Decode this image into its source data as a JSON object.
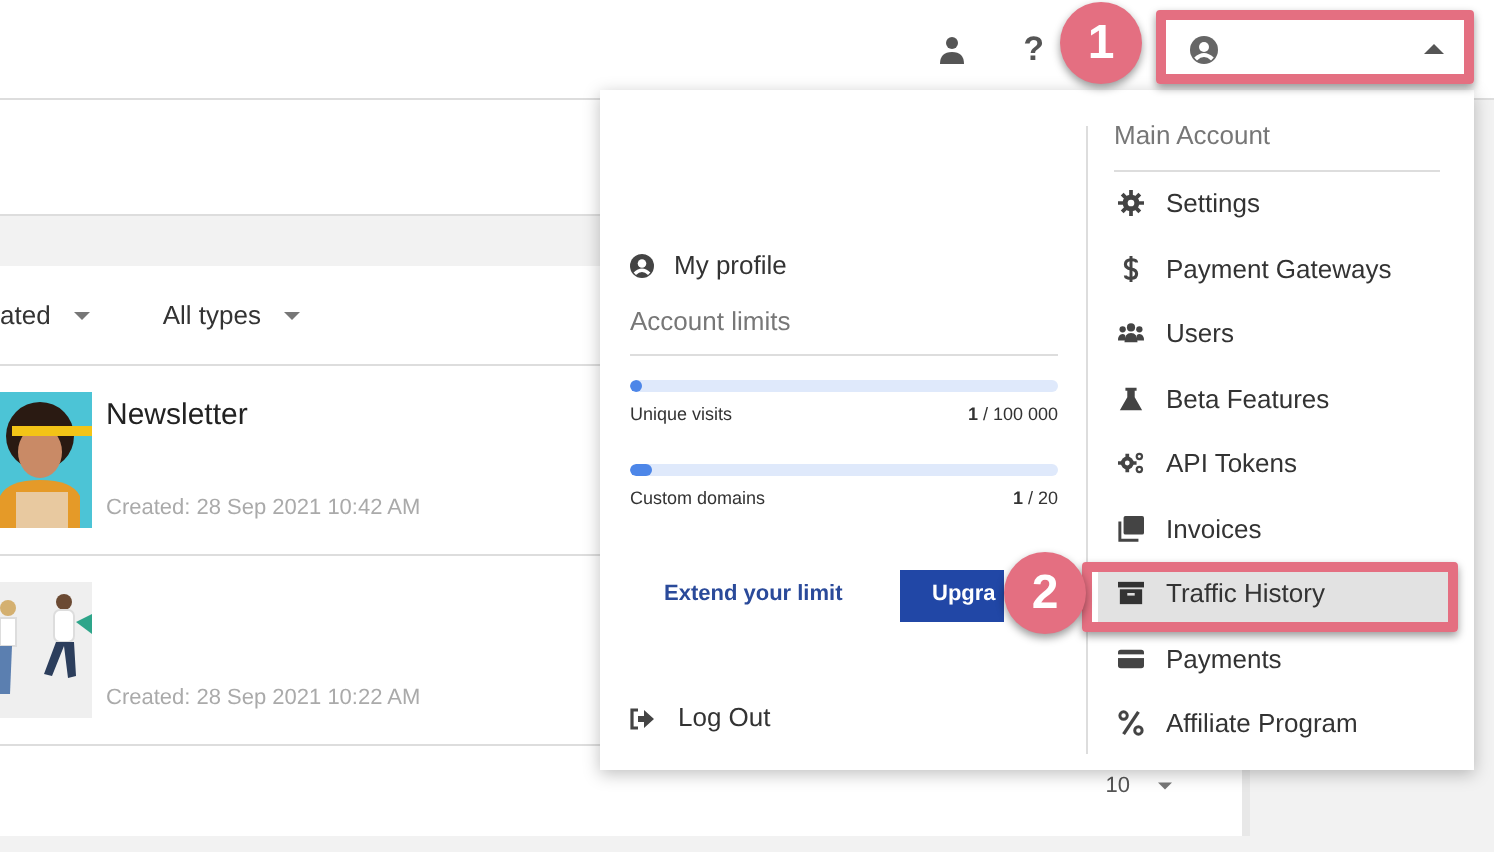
{
  "topbar": {
    "help_glyph": "?",
    "account_button": {
      "expanded": true
    }
  },
  "filters": [
    {
      "label": "ated"
    },
    {
      "label": "All types"
    }
  ],
  "items": [
    {
      "title": "Newsletter",
      "created": "Created: 28 Sep 2021 10:42 AM"
    },
    {
      "created": "Created: 28 Sep 2021 10:22 AM"
    }
  ],
  "pagination": {
    "page_size": "10"
  },
  "menu": {
    "profile": "My profile",
    "limits_title": "Account limits",
    "limits": [
      {
        "label": "Unique visits",
        "reading": "**1** / 100 000",
        "level": 0.01
      },
      {
        "label": "Custom domains",
        "reading": "**1** / 20",
        "level": 0.05
      }
    ],
    "extend_button": "Extend your limit",
    "upgrade_button": "Upgra",
    "logout": "Log Out",
    "section_title": "Main Account",
    "items": [
      {
        "label": "Settings",
        "selected": false
      },
      {
        "label": "Payment Gateways",
        "selected": false
      },
      {
        "label": "Users",
        "selected": false
      },
      {
        "label": "Beta Features",
        "selected": false
      },
      {
        "label": "API Tokens",
        "selected": false
      },
      {
        "label": "Invoices",
        "selected": false
      },
      {
        "label": "Traffic History",
        "selected": true
      },
      {
        "label": "Payments",
        "selected": false
      },
      {
        "label": "Affiliate Program",
        "selected": false
      }
    ]
  },
  "callouts": [
    {
      "number": "1"
    },
    {
      "number": "2"
    }
  ]
}
